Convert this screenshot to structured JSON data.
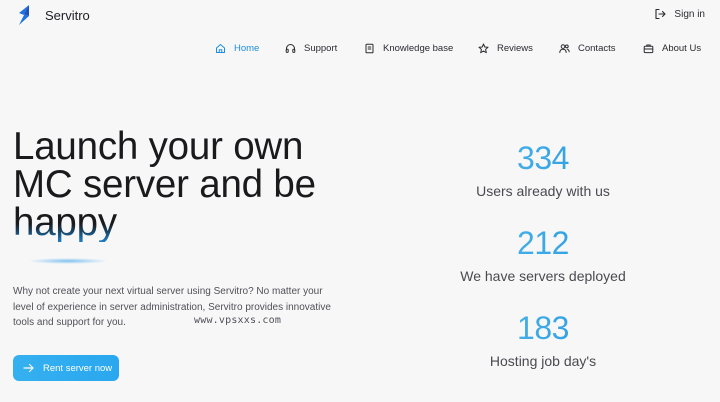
{
  "header": {
    "brand": "Servitro",
    "signin_label": "Sign in"
  },
  "nav": {
    "items": [
      {
        "label": "Home",
        "icon": "home-icon",
        "active": true
      },
      {
        "label": "Support",
        "icon": "headphones-icon",
        "active": false
      },
      {
        "label": "Knowledge base",
        "icon": "book-icon",
        "active": false
      },
      {
        "label": "Reviews",
        "icon": "star-icon",
        "active": false
      },
      {
        "label": "Contacts",
        "icon": "users-icon",
        "active": false
      },
      {
        "label": "About Us",
        "icon": "briefcase-icon",
        "active": false
      }
    ]
  },
  "hero": {
    "title_lines": [
      "Launch your own",
      "MC server and be",
      "happy"
    ],
    "description": "Why not create your next virtual server using Servitro? No matter your level of experience in server administration, Servitro provides innovative tools and support for you.",
    "watermark": "www.vpsxxs.com",
    "cta_label": "Rent server now"
  },
  "stats": [
    {
      "value": "334",
      "label": "Users already with us"
    },
    {
      "value": "212",
      "label": "We have servers deployed"
    },
    {
      "value": "183",
      "label": "Hosting job day's"
    }
  ],
  "colors": {
    "accent": "#2aa7ef",
    "active_nav": "#1d8fe0",
    "background": "#f7f7f8"
  }
}
